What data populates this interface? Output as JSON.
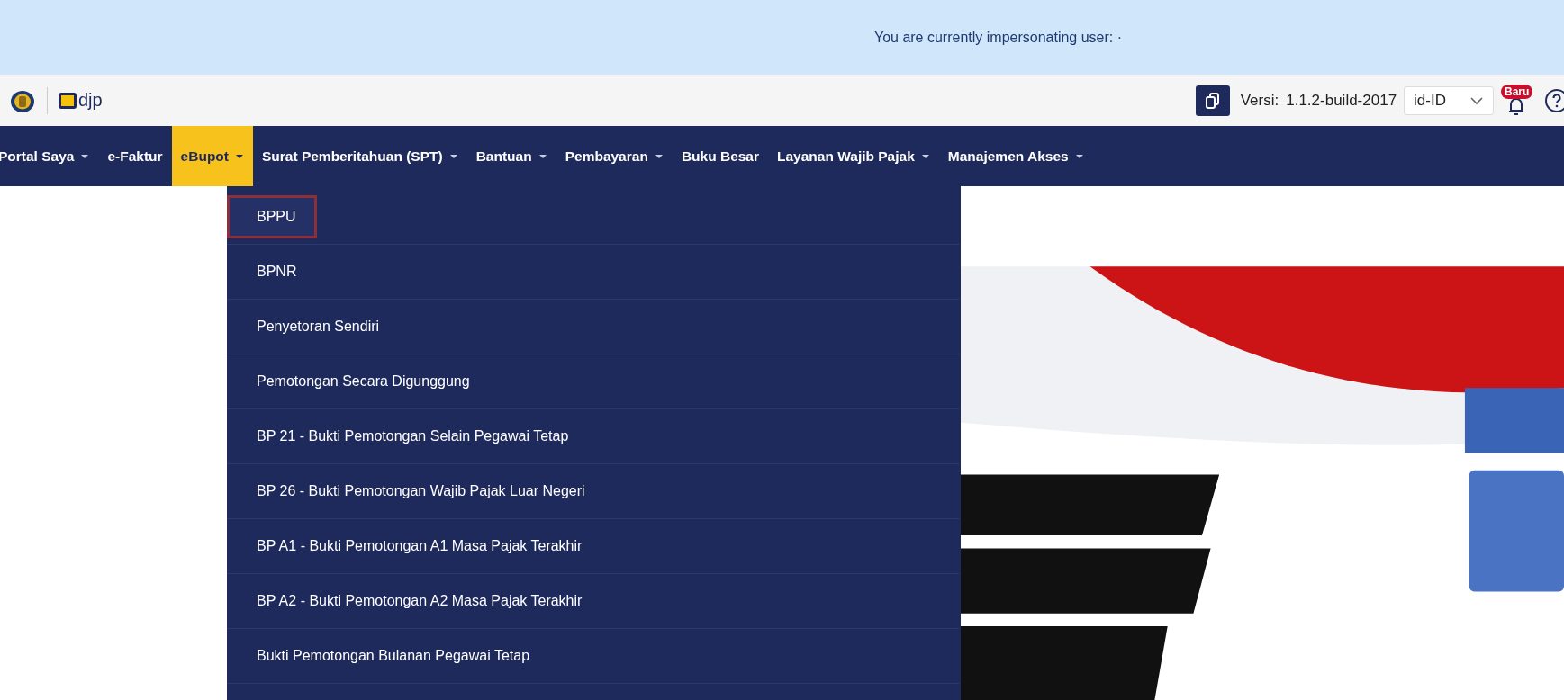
{
  "notice": {
    "text": "You are currently impersonating user: ·"
  },
  "header": {
    "logo_text": "djp",
    "version_label": "Versi:",
    "version": "1.1.2-build-2017",
    "language": {
      "value": "id-ID"
    },
    "notification_badge": "Baru"
  },
  "nav": [
    {
      "label": "Portal Saya",
      "has_caret": true,
      "selected": false
    },
    {
      "label": "e-Faktur",
      "has_caret": false,
      "selected": false
    },
    {
      "label": "eBupot",
      "has_caret": true,
      "selected": true
    },
    {
      "label": "Surat Pemberitahuan (SPT)",
      "has_caret": true,
      "selected": false
    },
    {
      "label": "Bantuan",
      "has_caret": true,
      "selected": false
    },
    {
      "label": "Pembayaran",
      "has_caret": true,
      "selected": false
    },
    {
      "label": "Buku Besar",
      "has_caret": false,
      "selected": false
    },
    {
      "label": "Layanan Wajib Pajak",
      "has_caret": true,
      "selected": false
    },
    {
      "label": "Manajemen Akses",
      "has_caret": true,
      "selected": false
    }
  ],
  "dropdown": [
    {
      "label": "BPPU",
      "selected": true
    },
    {
      "label": "BPNR",
      "selected": false
    },
    {
      "label": "Penyetoran Sendiri",
      "selected": false
    },
    {
      "label": "Pemotongan Secara Digunggung",
      "selected": false
    },
    {
      "label": "BP 21 - Bukti Pemotongan Selain Pegawai Tetap",
      "selected": false
    },
    {
      "label": "BP 26 - Bukti Pemotongan Wajib Pajak Luar Negeri",
      "selected": false
    },
    {
      "label": "BP A1 - Bukti Pemotongan A1 Masa Pajak Terakhir",
      "selected": false
    },
    {
      "label": "BP A2 - Bukti Pemotongan A2 Masa Pajak Terakhir",
      "selected": false
    },
    {
      "label": "Bukti Pemotongan Bulanan Pegawai Tetap",
      "selected": false
    }
  ]
}
